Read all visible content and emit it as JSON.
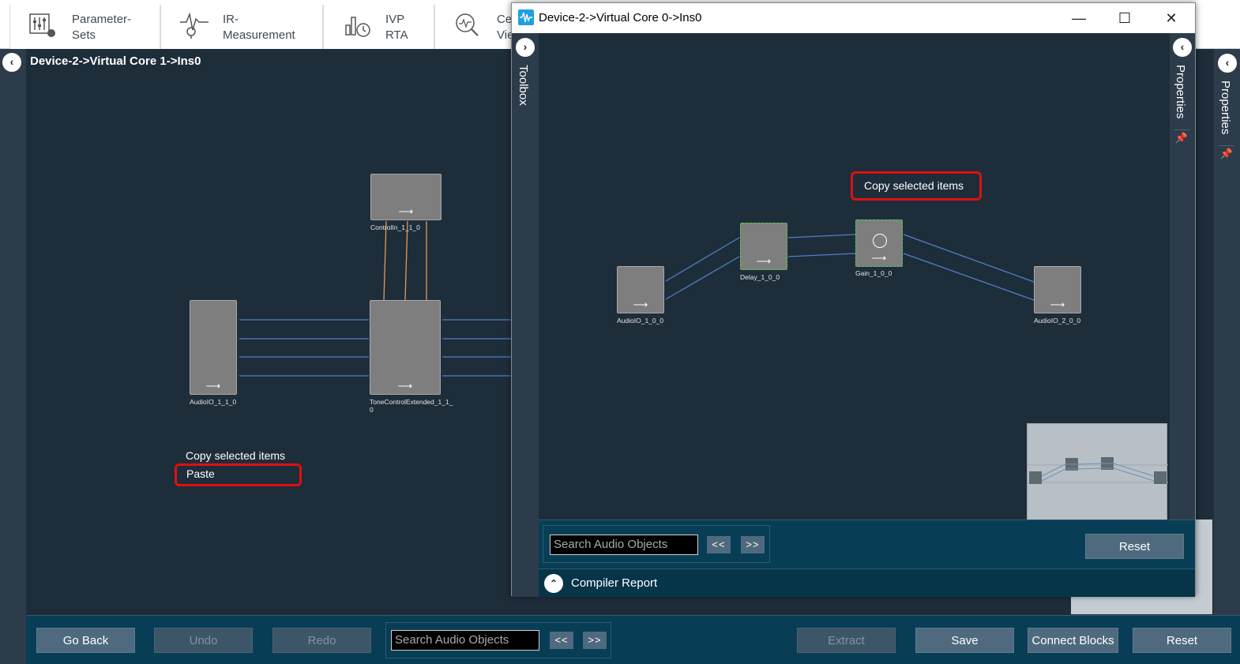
{
  "ribbon": {
    "tabs": [
      {
        "label": "Parameter-\nSets",
        "icon": "parameter-sets-icon"
      },
      {
        "label": "IR-\nMeasurement",
        "icon": "ir-measurement-icon"
      },
      {
        "label": "IVP\nRTA",
        "icon": "ivp-rta-icon"
      },
      {
        "label": "Ce\nVie",
        "icon": "magnifier-icon"
      }
    ]
  },
  "main": {
    "title": "Device-2->Virtual Core 1->Ins0",
    "blocks": {
      "control_in": "ControlIn_1_1_0",
      "audio_io": "AudioIO_1_1_0",
      "tone_control": "ToneControlExtended_1_1_\n0"
    },
    "context_menu": {
      "copy": "Copy selected items",
      "paste": "Paste"
    },
    "properties_label": "Properties"
  },
  "child_window": {
    "title": "Device-2->Virtual Core 0->Ins0",
    "toolbox_label": "Toolbox",
    "properties_label": "Properties",
    "copy_hint": "Copy selected items",
    "blocks": {
      "audio_in": "AudioIO_1_0_0",
      "delay": "Delay_1_0_0",
      "gain": "Gain_1_0_0",
      "audio_out": "AudioIO_2_0_0"
    },
    "search_placeholder": "Search Audio Objects",
    "prev": "<<",
    "next": ">>",
    "reset": "Reset",
    "compiler_report": "Compiler Report"
  },
  "bottom_toolbar": {
    "go_back": "Go Back",
    "undo": "Undo",
    "redo": "Redo",
    "search_placeholder": "Search Audio Objects",
    "prev": "<<",
    "next": ">>",
    "extract": "Extract",
    "save": "Save",
    "connect_blocks": "Connect Blocks",
    "reset": "Reset"
  },
  "colors": {
    "canvas": "#1e2d3a",
    "toolbar": "#083d56",
    "block": "#7e7e7e",
    "wire": "#4f7fc9",
    "control_wire": "#e39a4f",
    "highlight": "#e01010"
  }
}
